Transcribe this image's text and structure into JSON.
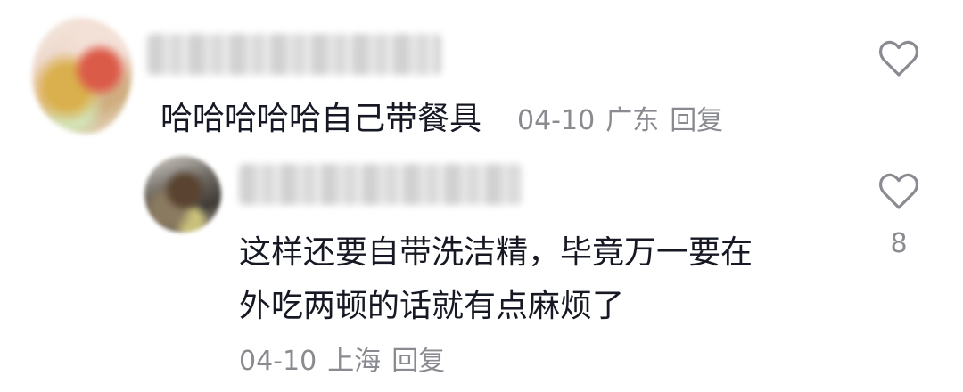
{
  "comments": [
    {
      "text": "哈哈哈哈哈自己带餐具",
      "date": "04-10",
      "location": "广东",
      "reply_label": "回复",
      "like_count": ""
    },
    {
      "text_line1": "这样还要自带洗洁精，毕竟万一要在",
      "text_line2": "外吃两顿的话就有点麻烦了",
      "date": "04-10",
      "location": "上海",
      "reply_label": "回复",
      "like_count": "8"
    }
  ],
  "icons": {
    "like": "heart-outline-icon"
  }
}
